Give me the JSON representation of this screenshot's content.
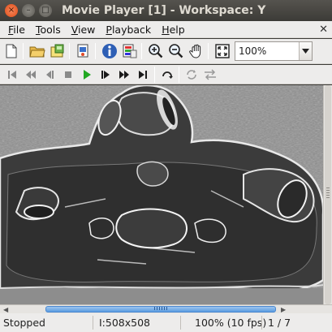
{
  "window": {
    "title": "Movie Player [1] - Workspace: Y",
    "buttons": {
      "close": "×",
      "minimize": "–",
      "maximize": "□"
    }
  },
  "menu": {
    "items": [
      {
        "label": "File",
        "mnemonic": "F",
        "rest": "ile"
      },
      {
        "label": "Tools",
        "mnemonic": "T",
        "rest": "ools"
      },
      {
        "label": "View",
        "mnemonic": "V",
        "rest": "iew"
      },
      {
        "label": "Playback",
        "mnemonic": "P",
        "rest": "layback"
      },
      {
        "label": "Help",
        "mnemonic": "H",
        "rest": "elp"
      }
    ],
    "close_glyph": "✕"
  },
  "toolbar": {
    "icons": [
      "new-file-icon",
      "open-folder-icon",
      "export-icon",
      "copy-workspace-icon",
      "info-icon",
      "colormap-icon",
      "zoom-in-icon",
      "zoom-out-icon",
      "pan-hand-icon",
      "fit-window-icon"
    ],
    "zoom_value": "100%"
  },
  "playback": {
    "icons": [
      "go-first-icon",
      "step-back-icon",
      "play-backward-icon",
      "stop-icon",
      "play-icon",
      "step-forward-icon",
      "fast-forward-icon",
      "go-last-icon",
      "loop-icon",
      "repeat-icon",
      "swap-direction-icon"
    ],
    "play_color": "#22a822"
  },
  "status": {
    "state": "Stopped",
    "size": "I:508x508",
    "zoom_fps": "100% (10 fps)",
    "frame": "1 / 7"
  },
  "colors": {
    "titlebar": "#3c3b37",
    "panel": "#edeceb",
    "scroll_accent": "#5a9be0"
  }
}
